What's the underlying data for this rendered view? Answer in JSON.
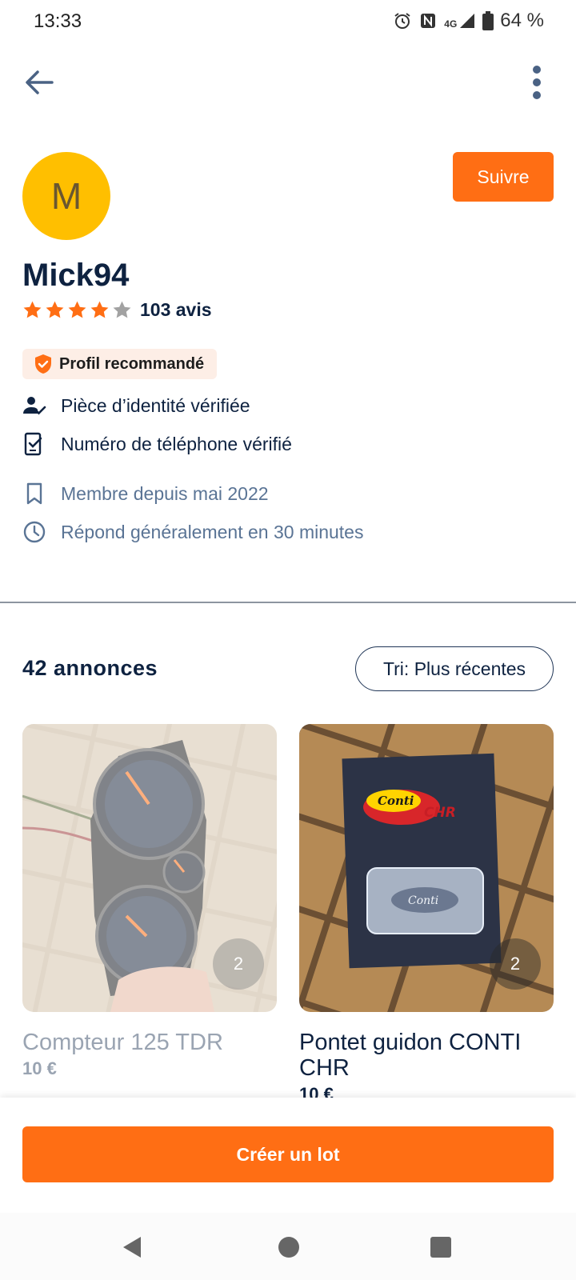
{
  "status_bar": {
    "time": "13:33",
    "network": "4G",
    "battery": "64 %",
    "icons": [
      "alarm-icon",
      "nfc-icon",
      "signal-icon",
      "battery-icon"
    ]
  },
  "app_bar": {
    "back_icon": "arrow-left-icon",
    "menu_icon": "more-vertical-icon"
  },
  "profile": {
    "avatar_letter": "M",
    "avatar_color": "#ffbf00",
    "follow_label": "Suivre",
    "username": "Mick94",
    "rating_stars": 4,
    "rating_max": 5,
    "reviews": "103 avis",
    "badge_label": "Profil recommandé",
    "verifications": [
      {
        "icon": "person-check-icon",
        "label": "Pièce d’identité vérifiée"
      },
      {
        "icon": "phone-check-icon",
        "label": "Numéro de téléphone vérifié"
      }
    ],
    "details": [
      {
        "icon": "bookmark-icon",
        "label": "Membre depuis mai 2022"
      },
      {
        "icon": "clock-icon",
        "label": "Répond généralement en 30 minutes"
      }
    ]
  },
  "listings": {
    "count_label": "42 annonces",
    "sort_label": "Tri: Plus récentes",
    "items": [
      {
        "title": "Compteur 125 TDR",
        "price": "10 €",
        "photo_count": "2"
      },
      {
        "title": "Pontet guidon CONTI CHR",
        "price": "10 €",
        "photo_count": "2"
      }
    ]
  },
  "actions": {
    "create_lot_label": "Créer un lot"
  },
  "colors": {
    "accent": "#ff6e14",
    "text_primary": "#0e2240",
    "text_muted": "#5a7495",
    "badge_bg": "#fdeee6"
  }
}
